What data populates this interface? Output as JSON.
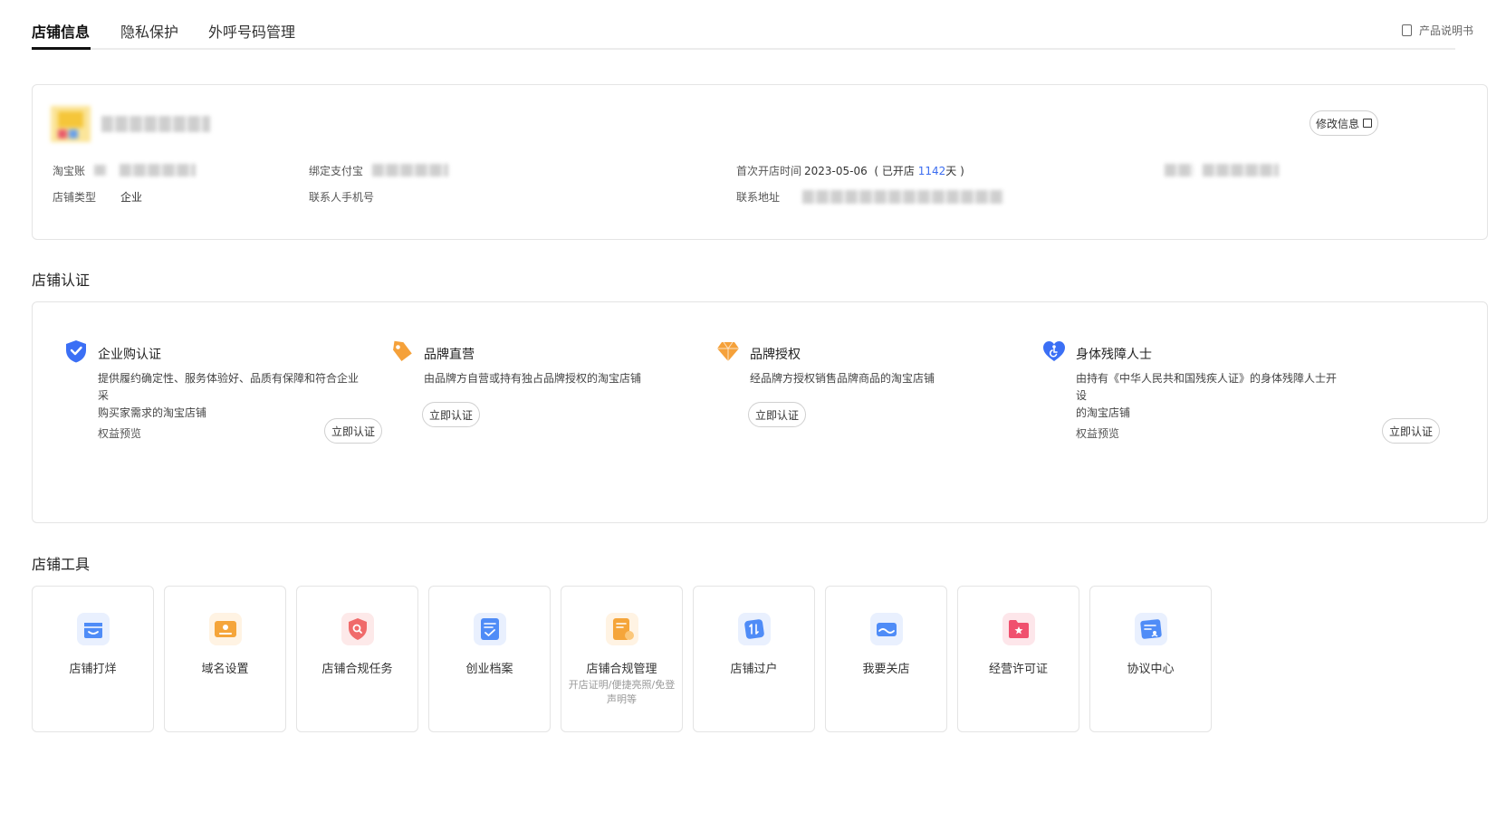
{
  "tabs": [
    {
      "label": "店铺信息",
      "active": true
    },
    {
      "label": "隐私保护",
      "active": false
    },
    {
      "label": "外呼号码管理",
      "active": false
    }
  ],
  "manual_link": {
    "label": "产品说明书",
    "icon": "book-icon"
  },
  "store_info": {
    "edit_button": "修改信息",
    "account_label": "淘宝账",
    "alipay_label": "绑定支付宝",
    "open_time_label": "首次开店时间",
    "open_date": "2023-05-06",
    "open_days_prefix": "( 已开店 ",
    "open_days": "1142",
    "open_days_suffix": "天 )",
    "store_type_label": "店铺类型",
    "store_type_value": "企业",
    "phone_label": "联系人手机号",
    "address_label": "联系地址"
  },
  "certification": {
    "title": "店铺认证",
    "items": [
      {
        "icon": "shield-check-icon",
        "color": "#3b6ff5",
        "title": "企业购认证",
        "desc": [
          "提供履约确定性、服务体验好、品质有保障和符合企业采",
          "购买家需求的淘宝店铺"
        ],
        "preview": "权益预览",
        "button": "立即认证"
      },
      {
        "icon": "tag-icon",
        "color": "#f5a13a",
        "title": "品牌直营",
        "desc": [
          "由品牌方自营或持有独占品牌授权的淘宝店铺"
        ],
        "preview": "",
        "button": "立即认证"
      },
      {
        "icon": "diamond-icon",
        "color": "#f5a13a",
        "title": "品牌授权",
        "desc": [
          "经品牌方授权销售品牌商品的淘宝店铺"
        ],
        "preview": "",
        "button": "立即认证"
      },
      {
        "icon": "heart-accessibility-icon",
        "color": "#3b6ff5",
        "title": "身体残障人士",
        "desc": [
          "由持有《中华人民共和国残疾人证》的身体残障人士开设",
          "的淘宝店铺"
        ],
        "preview": "权益预览",
        "button": "立即认证"
      }
    ]
  },
  "tools": {
    "title": "店铺工具",
    "items": [
      {
        "name": "店铺打烊",
        "icon": "store-close-icon",
        "color": "#4f8cf7",
        "desc": ""
      },
      {
        "name": "域名设置",
        "icon": "domain-icon",
        "color": "#f5a53a",
        "desc": ""
      },
      {
        "name": "店铺合规任务",
        "icon": "compliance-shield-icon",
        "color": "#f06a6a",
        "desc": ""
      },
      {
        "name": "创业档案",
        "icon": "archive-icon",
        "color": "#4f8cf7",
        "desc": ""
      },
      {
        "name": "店铺合规管理",
        "icon": "compliance-doc-icon",
        "color": "#f5a53a",
        "desc": "开店证明/便捷亮照/免登声明等"
      },
      {
        "name": "店铺过户",
        "icon": "transfer-icon",
        "color": "#4f8cf7",
        "desc": ""
      },
      {
        "name": "我要关店",
        "icon": "close-store-icon",
        "color": "#4f8cf7",
        "desc": ""
      },
      {
        "name": "经营许可证",
        "icon": "license-folder-icon",
        "color": "#f0506e",
        "desc": ""
      },
      {
        "name": "协议中心",
        "icon": "agreement-icon",
        "color": "#4f8cf7",
        "desc": ""
      }
    ]
  }
}
